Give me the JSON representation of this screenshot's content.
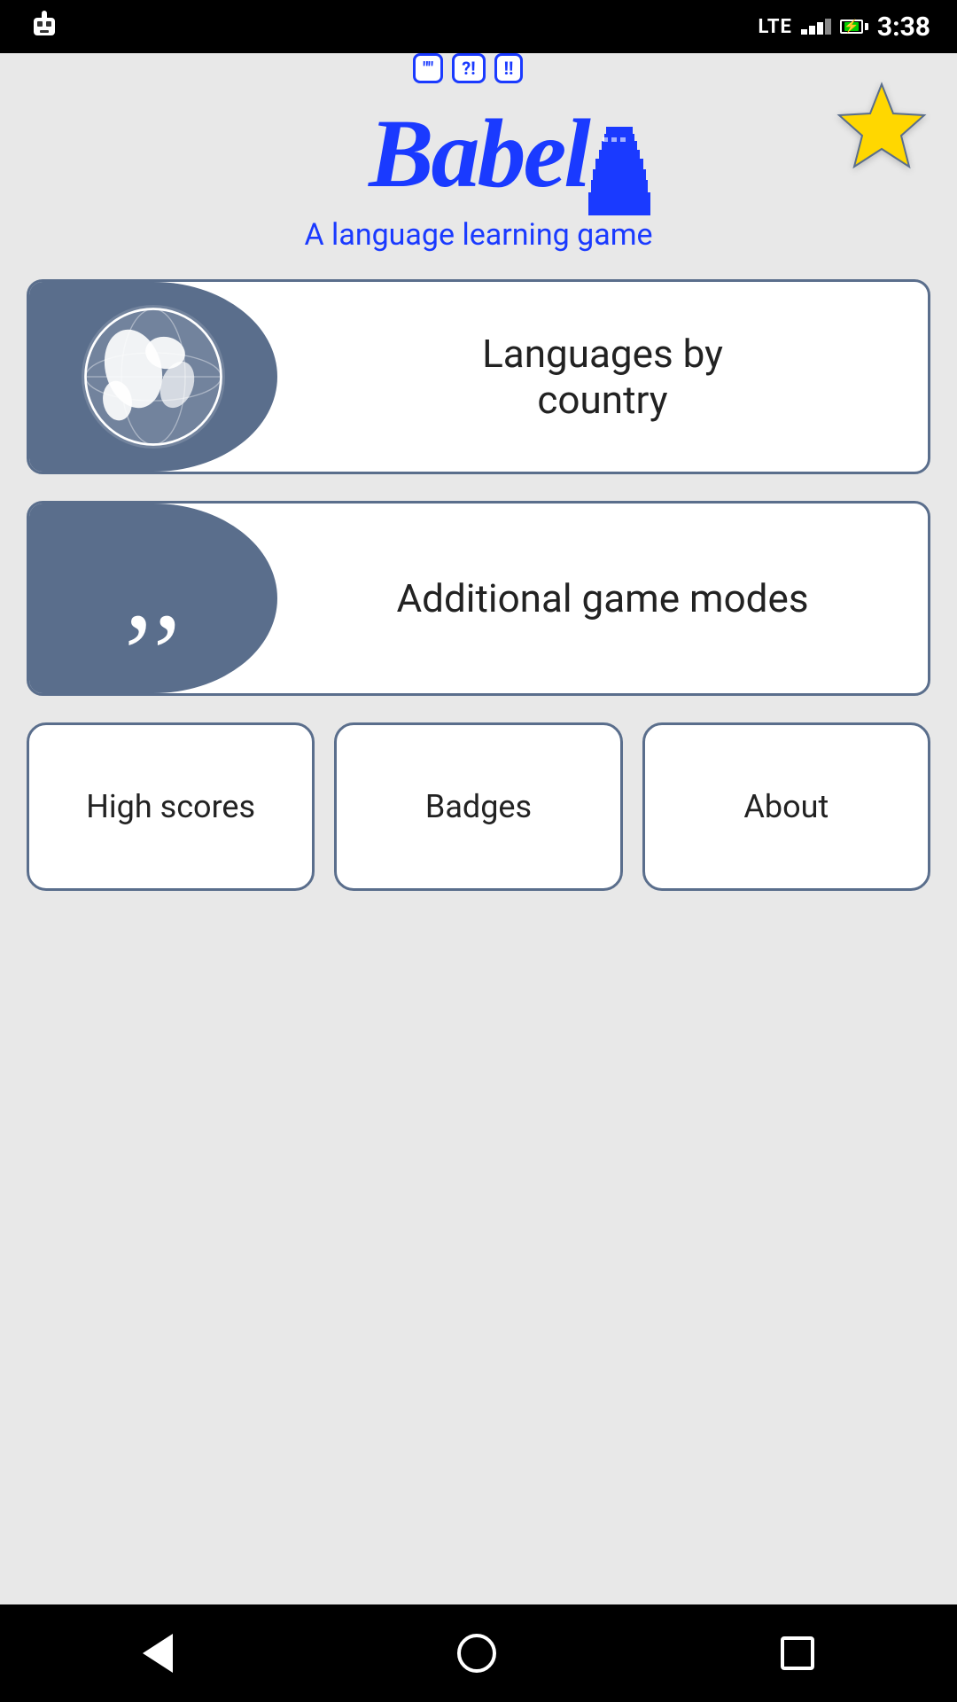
{
  "status_bar": {
    "time": "3:38",
    "network": "LTE"
  },
  "header": {
    "logo_text": "Babel",
    "subtitle": "A language learning game",
    "star_emoji": "⭐"
  },
  "buttons": {
    "languages_by_country": "Languages by\ncountry",
    "additional_game_modes": "Additional game modes",
    "high_scores": "High scores",
    "badges": "Badges",
    "about": "About"
  },
  "nav": {
    "back": "back",
    "home": "home",
    "recent": "recent"
  }
}
